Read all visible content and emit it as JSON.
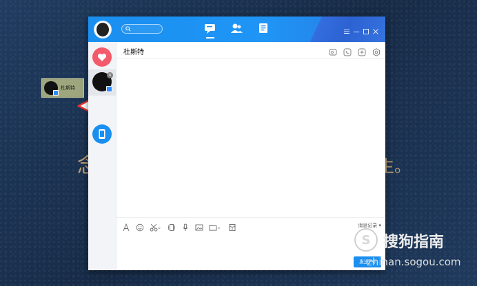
{
  "background": {
    "deco_left": "念",
    "deco_right": "生。"
  },
  "drag_card": {
    "label": "杜斯特"
  },
  "window": {
    "search_placeholder": "",
    "tabs": [
      {
        "name": "messages",
        "icon": "chat-bubble-icon",
        "active": true
      },
      {
        "name": "contacts",
        "icon": "contacts-icon",
        "active": false
      },
      {
        "name": "space",
        "icon": "document-icon",
        "active": false
      }
    ],
    "controls": [
      "menu",
      "minimize",
      "maximize",
      "close"
    ]
  },
  "sidebar": {
    "items": [
      {
        "name": "favorites",
        "icon": "heart-icon"
      },
      {
        "name": "杜斯特",
        "icon": "avatar",
        "selected": true
      },
      {
        "name": "my-device",
        "icon": "phone-icon"
      }
    ]
  },
  "chat": {
    "title": "杜斯特",
    "header_icons": [
      "screen-share-icon",
      "phone-call-icon",
      "add-icon",
      "settings-icon"
    ],
    "toolbar": [
      "font-icon",
      "emoji-icon",
      "screenshot-icon",
      "shake-icon",
      "voice-icon",
      "image-icon",
      "folder-icon",
      "red-packet-icon"
    ],
    "history_label": "消息记录",
    "send_label": "发送(S)"
  },
  "watermark": {
    "title": "搜狗指南",
    "url": "zhinan.sogou.com"
  },
  "colors": {
    "brand_blue": "#1a8ff0",
    "favorite_red": "#f35a6a",
    "arrow_red": "#e8302f"
  }
}
